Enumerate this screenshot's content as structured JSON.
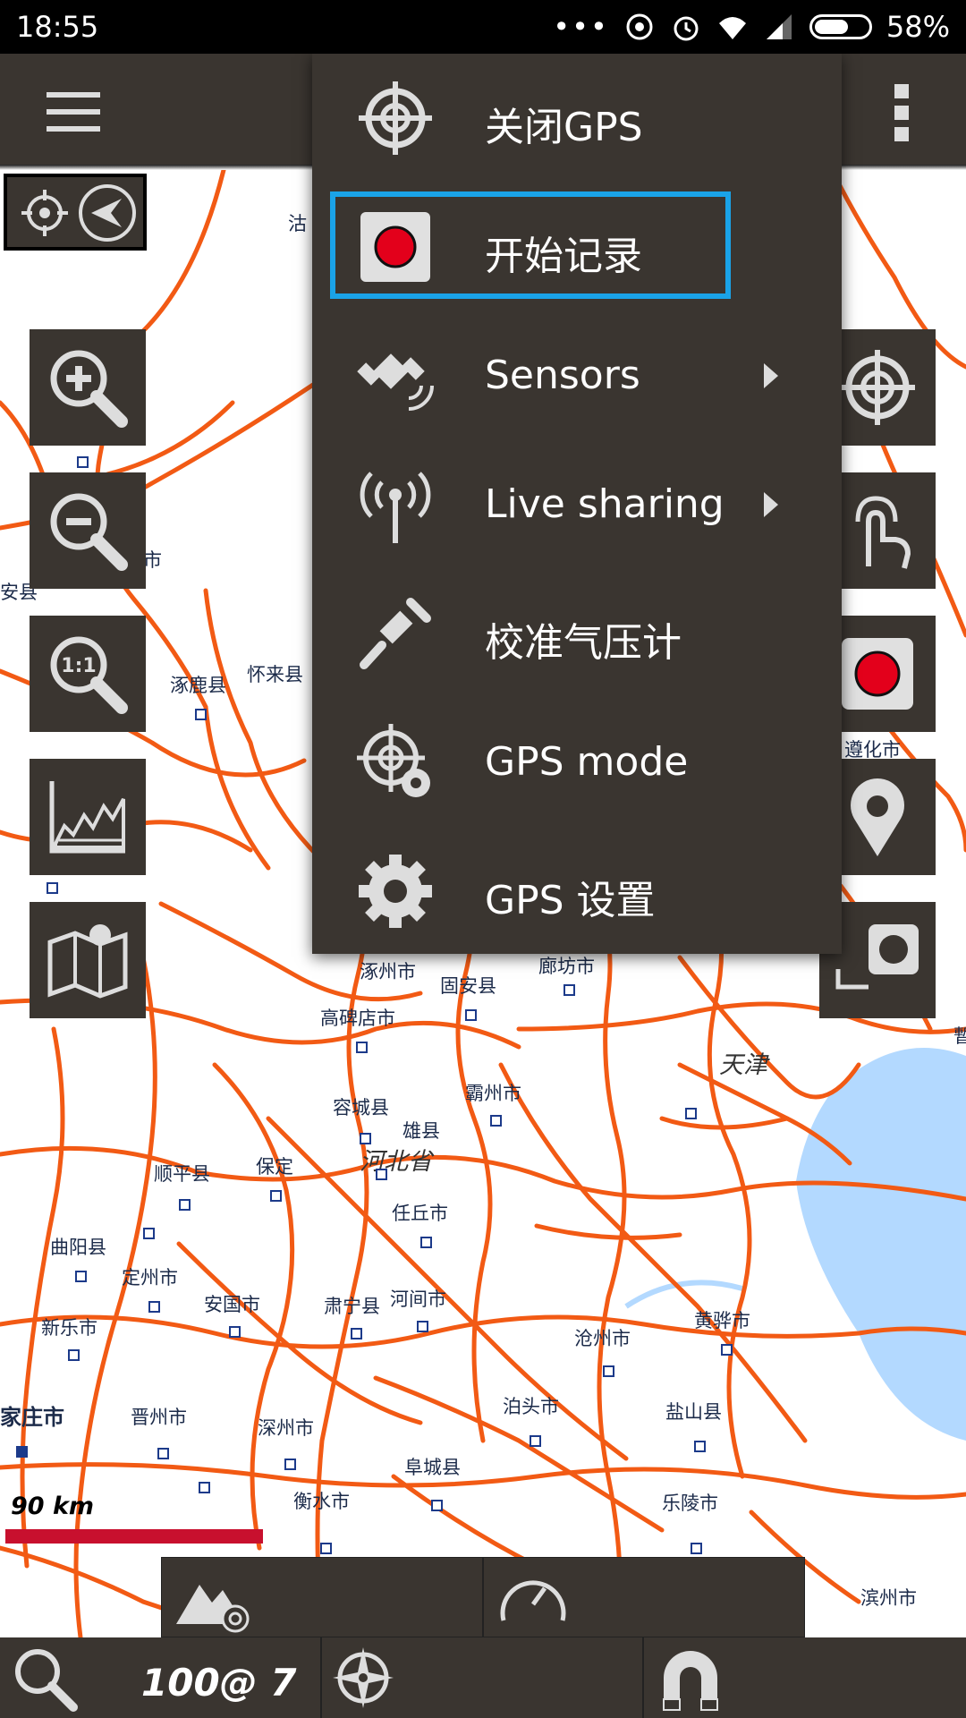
{
  "status_bar": {
    "time": "18:55",
    "battery": "58%",
    "battery_level": 0.58
  },
  "menu": {
    "items": [
      {
        "label": "关闭GPS",
        "icon": "crosshair-icon",
        "submenu": false
      },
      {
        "label": "开始记录",
        "icon": "record-icon",
        "submenu": false,
        "highlighted": true
      },
      {
        "label": "Sensors",
        "icon": "satellite-icon",
        "submenu": true
      },
      {
        "label": "Live sharing",
        "icon": "antenna-icon",
        "submenu": true
      },
      {
        "label": "校准气压计",
        "icon": "screwdriver-icon",
        "submenu": false
      },
      {
        "label": "GPS mode",
        "icon": "gps-settings-icon",
        "submenu": false
      },
      {
        "label": "GPS 设置",
        "icon": "gear-icon",
        "submenu": false
      }
    ]
  },
  "map": {
    "cities": {
      "c1": "沽",
      "c2": "市",
      "c3": "安县",
      "c4": "涿鹿县",
      "c5": "怀来县",
      "c6": "遵化市",
      "c7": "涿州市",
      "c8": "固安县",
      "c9": "廊坊市",
      "c10": "高碑店市",
      "c11": "天津",
      "c12": "容城县",
      "c13": "霸州市",
      "c14": "雄县",
      "c15": "河北省",
      "c16": "顺平县",
      "c17": "保定",
      "c18": "任丘市",
      "c19": "曲阳县",
      "c20": "定州市",
      "c21": "安国市",
      "c22": "肃宁县",
      "c23": "河间市",
      "c24": "沧州市",
      "c25": "黄骅市",
      "c26": "新乐市",
      "c27": "家庄市",
      "c28": "晋州市",
      "c29": "深州市",
      "c30": "泊头市",
      "c31": "盐山县",
      "c32": "阜城县",
      "c33": "衡水市",
      "c34": "乐陵市",
      "c35": "滨州市",
      "c36": "暫"
    },
    "scale": "90 km"
  },
  "bottom_bar": {
    "zoom_text": "100@ 7"
  },
  "colors": {
    "panel": "#3a3530",
    "road": "#f25a14",
    "highlight": "#1aa3e8",
    "scale_bar": "#c8102e",
    "sea": "#b3d9ff"
  }
}
